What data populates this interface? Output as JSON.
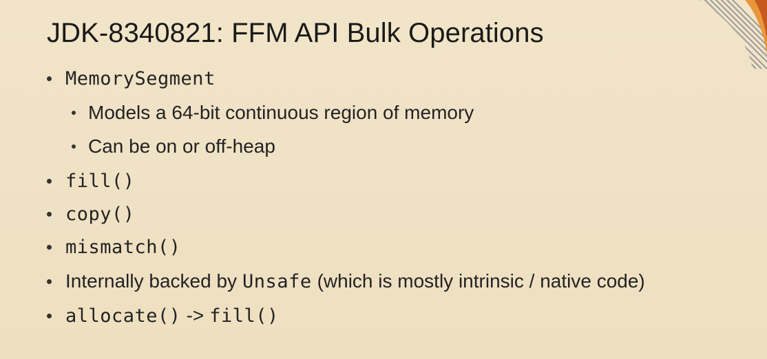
{
  "slide": {
    "title": "JDK-8340821: FFM API Bulk Operations",
    "bullets": {
      "b1_code": "MemorySegment",
      "b1_sub1": "Models a 64-bit continuous region of memory",
      "b1_sub2": "Can be on or off-heap",
      "b2_code": "fill()",
      "b3_code": "copy()",
      "b4_code": "mismatch()",
      "b5_pre": "Internally backed by",
      "b5_code": "Unsafe",
      "b5_post": "(which is mostly intrinsic / native code)",
      "b6_code_a": "allocate()",
      "b6_arrow": "->",
      "b6_code_b": "fill()"
    }
  },
  "colors": {
    "background": "#efe2c4",
    "text": "#1d1d1d",
    "accent_orange": "#e8963a"
  },
  "icons": {
    "corner_decoration": "striped-arc-decoration"
  }
}
